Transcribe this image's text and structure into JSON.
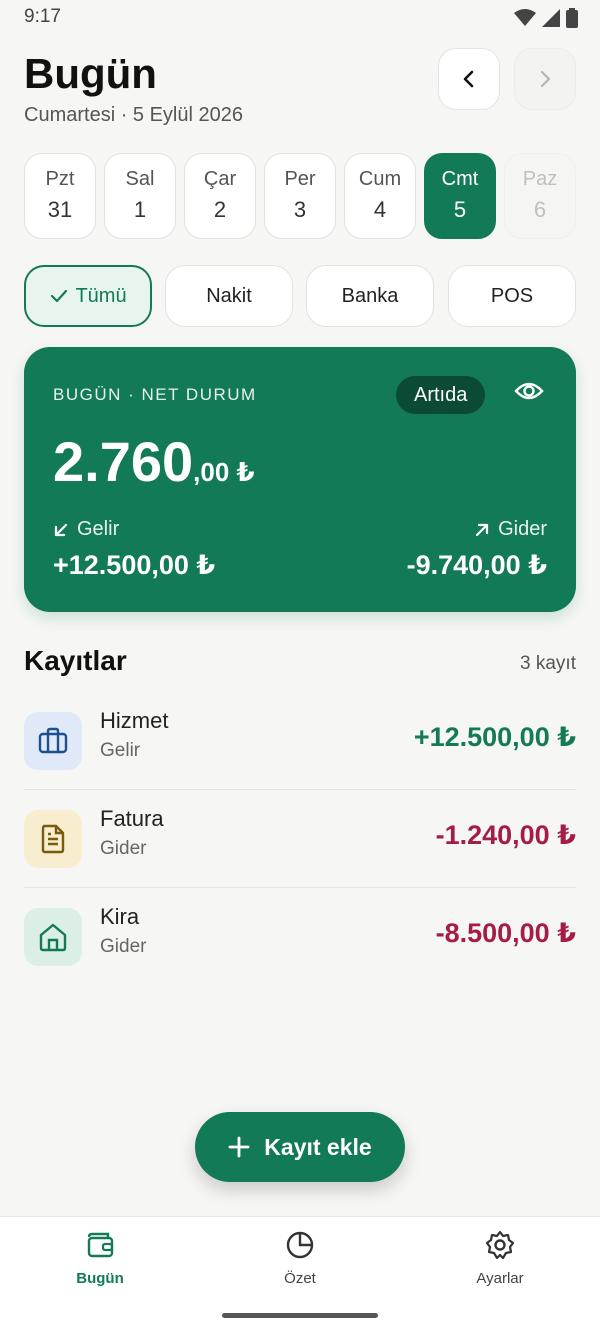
{
  "status_bar": {
    "time": "9:17"
  },
  "header": {
    "title": "Bugün",
    "subtitle": "Cumartesi · 5 Eylül 2026",
    "prev_icon": "chevron-left-icon",
    "next_icon": "chevron-right-icon"
  },
  "days": [
    {
      "name": "Pzt",
      "num": "31",
      "state": "normal"
    },
    {
      "name": "Sal",
      "num": "1",
      "state": "normal"
    },
    {
      "name": "Çar",
      "num": "2",
      "state": "normal"
    },
    {
      "name": "Per",
      "num": "3",
      "state": "normal"
    },
    {
      "name": "Cum",
      "num": "4",
      "state": "normal"
    },
    {
      "name": "Cmt",
      "num": "5",
      "state": "active"
    },
    {
      "name": "Paz",
      "num": "6",
      "state": "disabled"
    }
  ],
  "filters": [
    {
      "label": "Tümü",
      "active": true
    },
    {
      "label": "Nakit",
      "active": false
    },
    {
      "label": "Banka",
      "active": false
    },
    {
      "label": "POS",
      "active": false
    }
  ],
  "summary": {
    "label": "BUGÜN · NET DURUM",
    "badge": "Artıda",
    "amount_main": "2.760",
    "amount_decimal": ",00 ₺",
    "income_label": "Gelir",
    "income_value": "+12.500,00 ₺",
    "expense_label": "Gider",
    "expense_value": "-9.740,00 ₺"
  },
  "records": {
    "title": "Kayıtlar",
    "count": "3 kayıt",
    "items": [
      {
        "name": "Hizmet",
        "type": "Gelir",
        "amount": "+12.500,00 ₺",
        "icon": "briefcase-icon"
      },
      {
        "name": "Fatura",
        "type": "Gider",
        "amount": "-1.240,00 ₺",
        "icon": "document-icon"
      },
      {
        "name": "Kira",
        "type": "Gider",
        "amount": "-8.500,00 ₺",
        "icon": "home-icon"
      }
    ]
  },
  "fab": {
    "label": "Kayıt ekle"
  },
  "bottom_nav": [
    {
      "label": "Bugün",
      "icon": "wallet-icon",
      "active": true
    },
    {
      "label": "Özet",
      "icon": "pie-chart-icon",
      "active": false
    },
    {
      "label": "Ayarlar",
      "icon": "gear-icon",
      "active": false
    }
  ],
  "colors": {
    "primary": "#137a58",
    "negative": "#a51c44",
    "background": "#f6f6f4"
  }
}
